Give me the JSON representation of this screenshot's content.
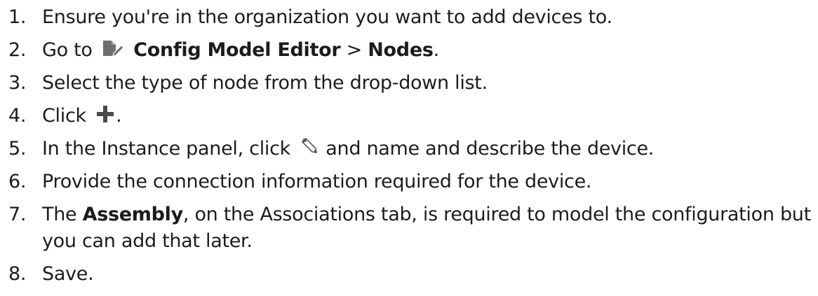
{
  "steps": [
    {
      "number": "1.",
      "text": "Ensure you're in the organization you want to add devices to."
    },
    {
      "number": "2.",
      "prefix": "Go to",
      "icon": "config-model-editor-icon",
      "bold_1": "Config Model Editor",
      "separator": " > ",
      "bold_2": "Nodes",
      "suffix": "."
    },
    {
      "number": "3.",
      "text": "Select the type of node from the drop-down list."
    },
    {
      "number": "4.",
      "prefix": "Click",
      "icon": "plus-icon",
      "suffix": "."
    },
    {
      "number": "5.",
      "prefix": "In the Instance panel, click",
      "icon": "pencil-icon",
      "suffix": "and name and describe the device."
    },
    {
      "number": "6.",
      "text": "Provide the connection information required for the device."
    },
    {
      "number": "7.",
      "prefix": "The ",
      "bold": "Assembly",
      "suffix": ", on the Associations tab, is required to model the configuration but you can add that later."
    },
    {
      "number": "8.",
      "text": "Save."
    }
  ],
  "colors": {
    "text": "#1c1c1c",
    "icon_gray": "#6e6e6e",
    "icon_dark": "#4a4a4a"
  }
}
